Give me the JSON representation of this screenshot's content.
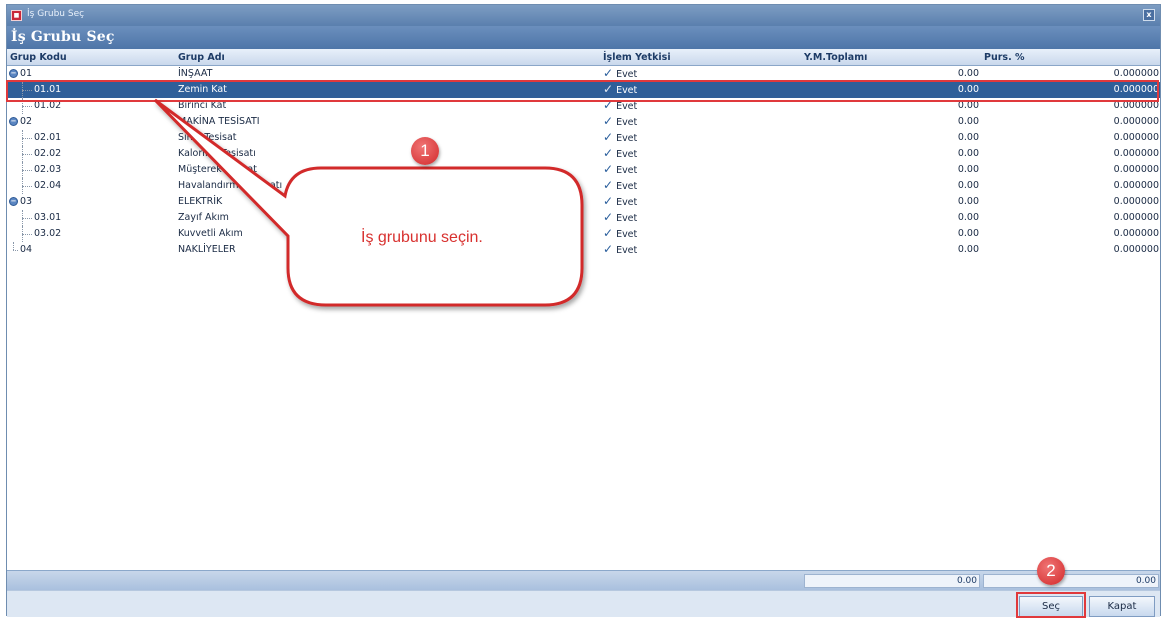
{
  "window": {
    "title": "İş Grubu Seç",
    "app_icon": "app-logo-icon",
    "close_icon": "close-icon",
    "close_glyph": "x"
  },
  "header": {
    "title": "İş Grubu Seç"
  },
  "columns": {
    "grup_kodu": "Grup Kodu",
    "grup_adi": "Grup Adı",
    "islem_yetkisi": "İşlem Yetkisi",
    "ym_toplami": "Y.M.Toplamı",
    "purs": "Purs. %"
  },
  "rows": [
    {
      "kod": "01",
      "adi": "İNŞAAT",
      "yetki": "Evet",
      "toplam": "0.00",
      "purs": "0.000000",
      "level": 0,
      "expandable": true,
      "selected": false
    },
    {
      "kod": "01.01",
      "adi": "Zemin Kat",
      "yetki": "Evet",
      "toplam": "0.00",
      "purs": "0.000000",
      "level": 1,
      "expandable": false,
      "selected": true
    },
    {
      "kod": "01.02",
      "adi": "Birinci Kat",
      "yetki": "Evet",
      "toplam": "0.00",
      "purs": "0.000000",
      "level": 1,
      "expandable": false,
      "selected": false
    },
    {
      "kod": "02",
      "adi": "MAKİNA TESİSATI",
      "yetki": "Evet",
      "toplam": "0.00",
      "purs": "0.000000",
      "level": 0,
      "expandable": true,
      "selected": false
    },
    {
      "kod": "02.01",
      "adi": "Sıhhi Tesisat",
      "yetki": "Evet",
      "toplam": "0.00",
      "purs": "0.000000",
      "level": 1,
      "expandable": false,
      "selected": false
    },
    {
      "kod": "02.02",
      "adi": "Kalorifer Tesisatı",
      "yetki": "Evet",
      "toplam": "0.00",
      "purs": "0.000000",
      "level": 1,
      "expandable": false,
      "selected": false
    },
    {
      "kod": "02.03",
      "adi": "Müşterek Tesisat",
      "yetki": "Evet",
      "toplam": "0.00",
      "purs": "0.000000",
      "level": 1,
      "expandable": false,
      "selected": false
    },
    {
      "kod": "02.04",
      "adi": "Havalandırma Tesisatı",
      "yetki": "Evet",
      "toplam": "0.00",
      "purs": "0.000000",
      "level": 1,
      "expandable": false,
      "selected": false
    },
    {
      "kod": "03",
      "adi": "ELEKTRİK",
      "yetki": "Evet",
      "toplam": "0.00",
      "purs": "0.000000",
      "level": 0,
      "expandable": true,
      "selected": false
    },
    {
      "kod": "03.01",
      "adi": "Zayıf Akım",
      "yetki": "Evet",
      "toplam": "0.00",
      "purs": "0.000000",
      "level": 1,
      "expandable": false,
      "selected": false
    },
    {
      "kod": "03.02",
      "adi": "Kuvvetli Akım",
      "yetki": "Evet",
      "toplam": "0.00",
      "purs": "0.000000",
      "level": 1,
      "expandable": false,
      "selected": false
    },
    {
      "kod": "04",
      "adi": "NAKLİYELER",
      "yetki": "Evet",
      "toplam": "0.00",
      "purs": "0.000000",
      "level": 0,
      "expandable": false,
      "selected": false
    }
  ],
  "check_glyph": "✓",
  "minus_glyph": "−",
  "footer": {
    "toplam_sum": "0.00",
    "purs_sum": "0.00"
  },
  "buttons": {
    "sec": "Seç",
    "kapat": "Kapat"
  },
  "annotations": {
    "step1_number": "1",
    "step1_text": "İş grubunu seçin.",
    "step2_number": "2",
    "accent_color": "#e0393c"
  }
}
